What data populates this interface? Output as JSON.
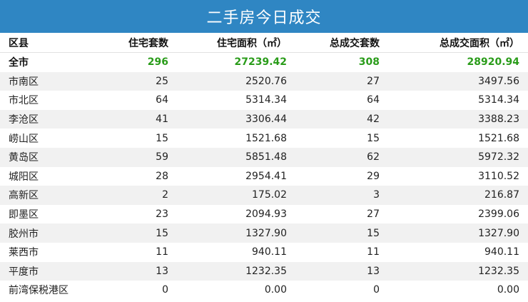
{
  "title": "二手房今日成交",
  "headers": {
    "district": "区县",
    "residential_units": "住宅套数",
    "residential_area": "住宅面积（㎡）",
    "total_units": "总成交套数",
    "total_area": "总成交面积（㎡）"
  },
  "rows": [
    {
      "district": "全市",
      "residential_units": "296",
      "residential_area": "27239.42",
      "total_units": "308",
      "total_area": "28920.94"
    },
    {
      "district": "市南区",
      "residential_units": "25",
      "residential_area": "2520.76",
      "total_units": "27",
      "total_area": "3497.56"
    },
    {
      "district": "市北区",
      "residential_units": "64",
      "residential_area": "5314.34",
      "total_units": "64",
      "total_area": "5314.34"
    },
    {
      "district": "李沧区",
      "residential_units": "41",
      "residential_area": "3306.44",
      "total_units": "42",
      "total_area": "3388.23"
    },
    {
      "district": "崂山区",
      "residential_units": "15",
      "residential_area": "1521.68",
      "total_units": "15",
      "total_area": "1521.68"
    },
    {
      "district": "黄岛区",
      "residential_units": "59",
      "residential_area": "5851.48",
      "total_units": "62",
      "total_area": "5972.32"
    },
    {
      "district": "城阳区",
      "residential_units": "28",
      "residential_area": "2954.41",
      "total_units": "29",
      "total_area": "3110.52"
    },
    {
      "district": "高新区",
      "residential_units": "2",
      "residential_area": "175.02",
      "total_units": "3",
      "total_area": "216.87"
    },
    {
      "district": "即墨区",
      "residential_units": "23",
      "residential_area": "2094.93",
      "total_units": "27",
      "total_area": "2399.06"
    },
    {
      "district": "胶州市",
      "residential_units": "15",
      "residential_area": "1327.90",
      "total_units": "15",
      "total_area": "1327.90"
    },
    {
      "district": "莱西市",
      "residential_units": "11",
      "residential_area": "940.11",
      "total_units": "11",
      "total_area": "940.11"
    },
    {
      "district": "平度市",
      "residential_units": "13",
      "residential_area": "1232.35",
      "total_units": "13",
      "total_area": "1232.35"
    },
    {
      "district": "前湾保税港区",
      "residential_units": "0",
      "residential_area": "0.00",
      "total_units": "0",
      "total_area": "0.00"
    }
  ],
  "colors": {
    "title_bg": "#2f86c3",
    "title_text": "#ffffff",
    "total_highlight": "#2a9c1a",
    "stripe": "#f1f1f1"
  }
}
